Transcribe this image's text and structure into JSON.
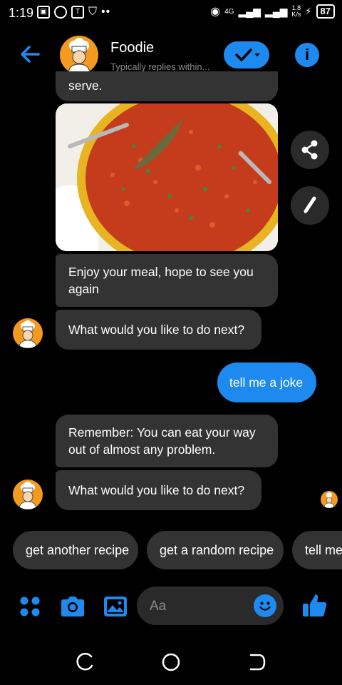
{
  "status_bar": {
    "time": "1:19",
    "network": "4G",
    "speed": "1.8",
    "speed_unit": "K/s",
    "battery": "87"
  },
  "header": {
    "title": "Foodie",
    "subtitle": "Typically replies within..."
  },
  "messages": {
    "partial_top": "serve.",
    "enjoy": "Enjoy your meal, hope to see you again",
    "next_1": "What would you like to do next?",
    "user_joke": "tell me a joke",
    "joke": "Remember: You can eat your way out of almost any problem.",
    "next_2": "What would you like to do next?"
  },
  "quick_replies": [
    "get another recipe",
    "get a random recipe",
    "tell me"
  ],
  "composer": {
    "placeholder": "Aa"
  },
  "colors": {
    "accent": "#1e8af0",
    "bubble_bg": "#333333",
    "avatar_bg": "#f39a1f"
  }
}
